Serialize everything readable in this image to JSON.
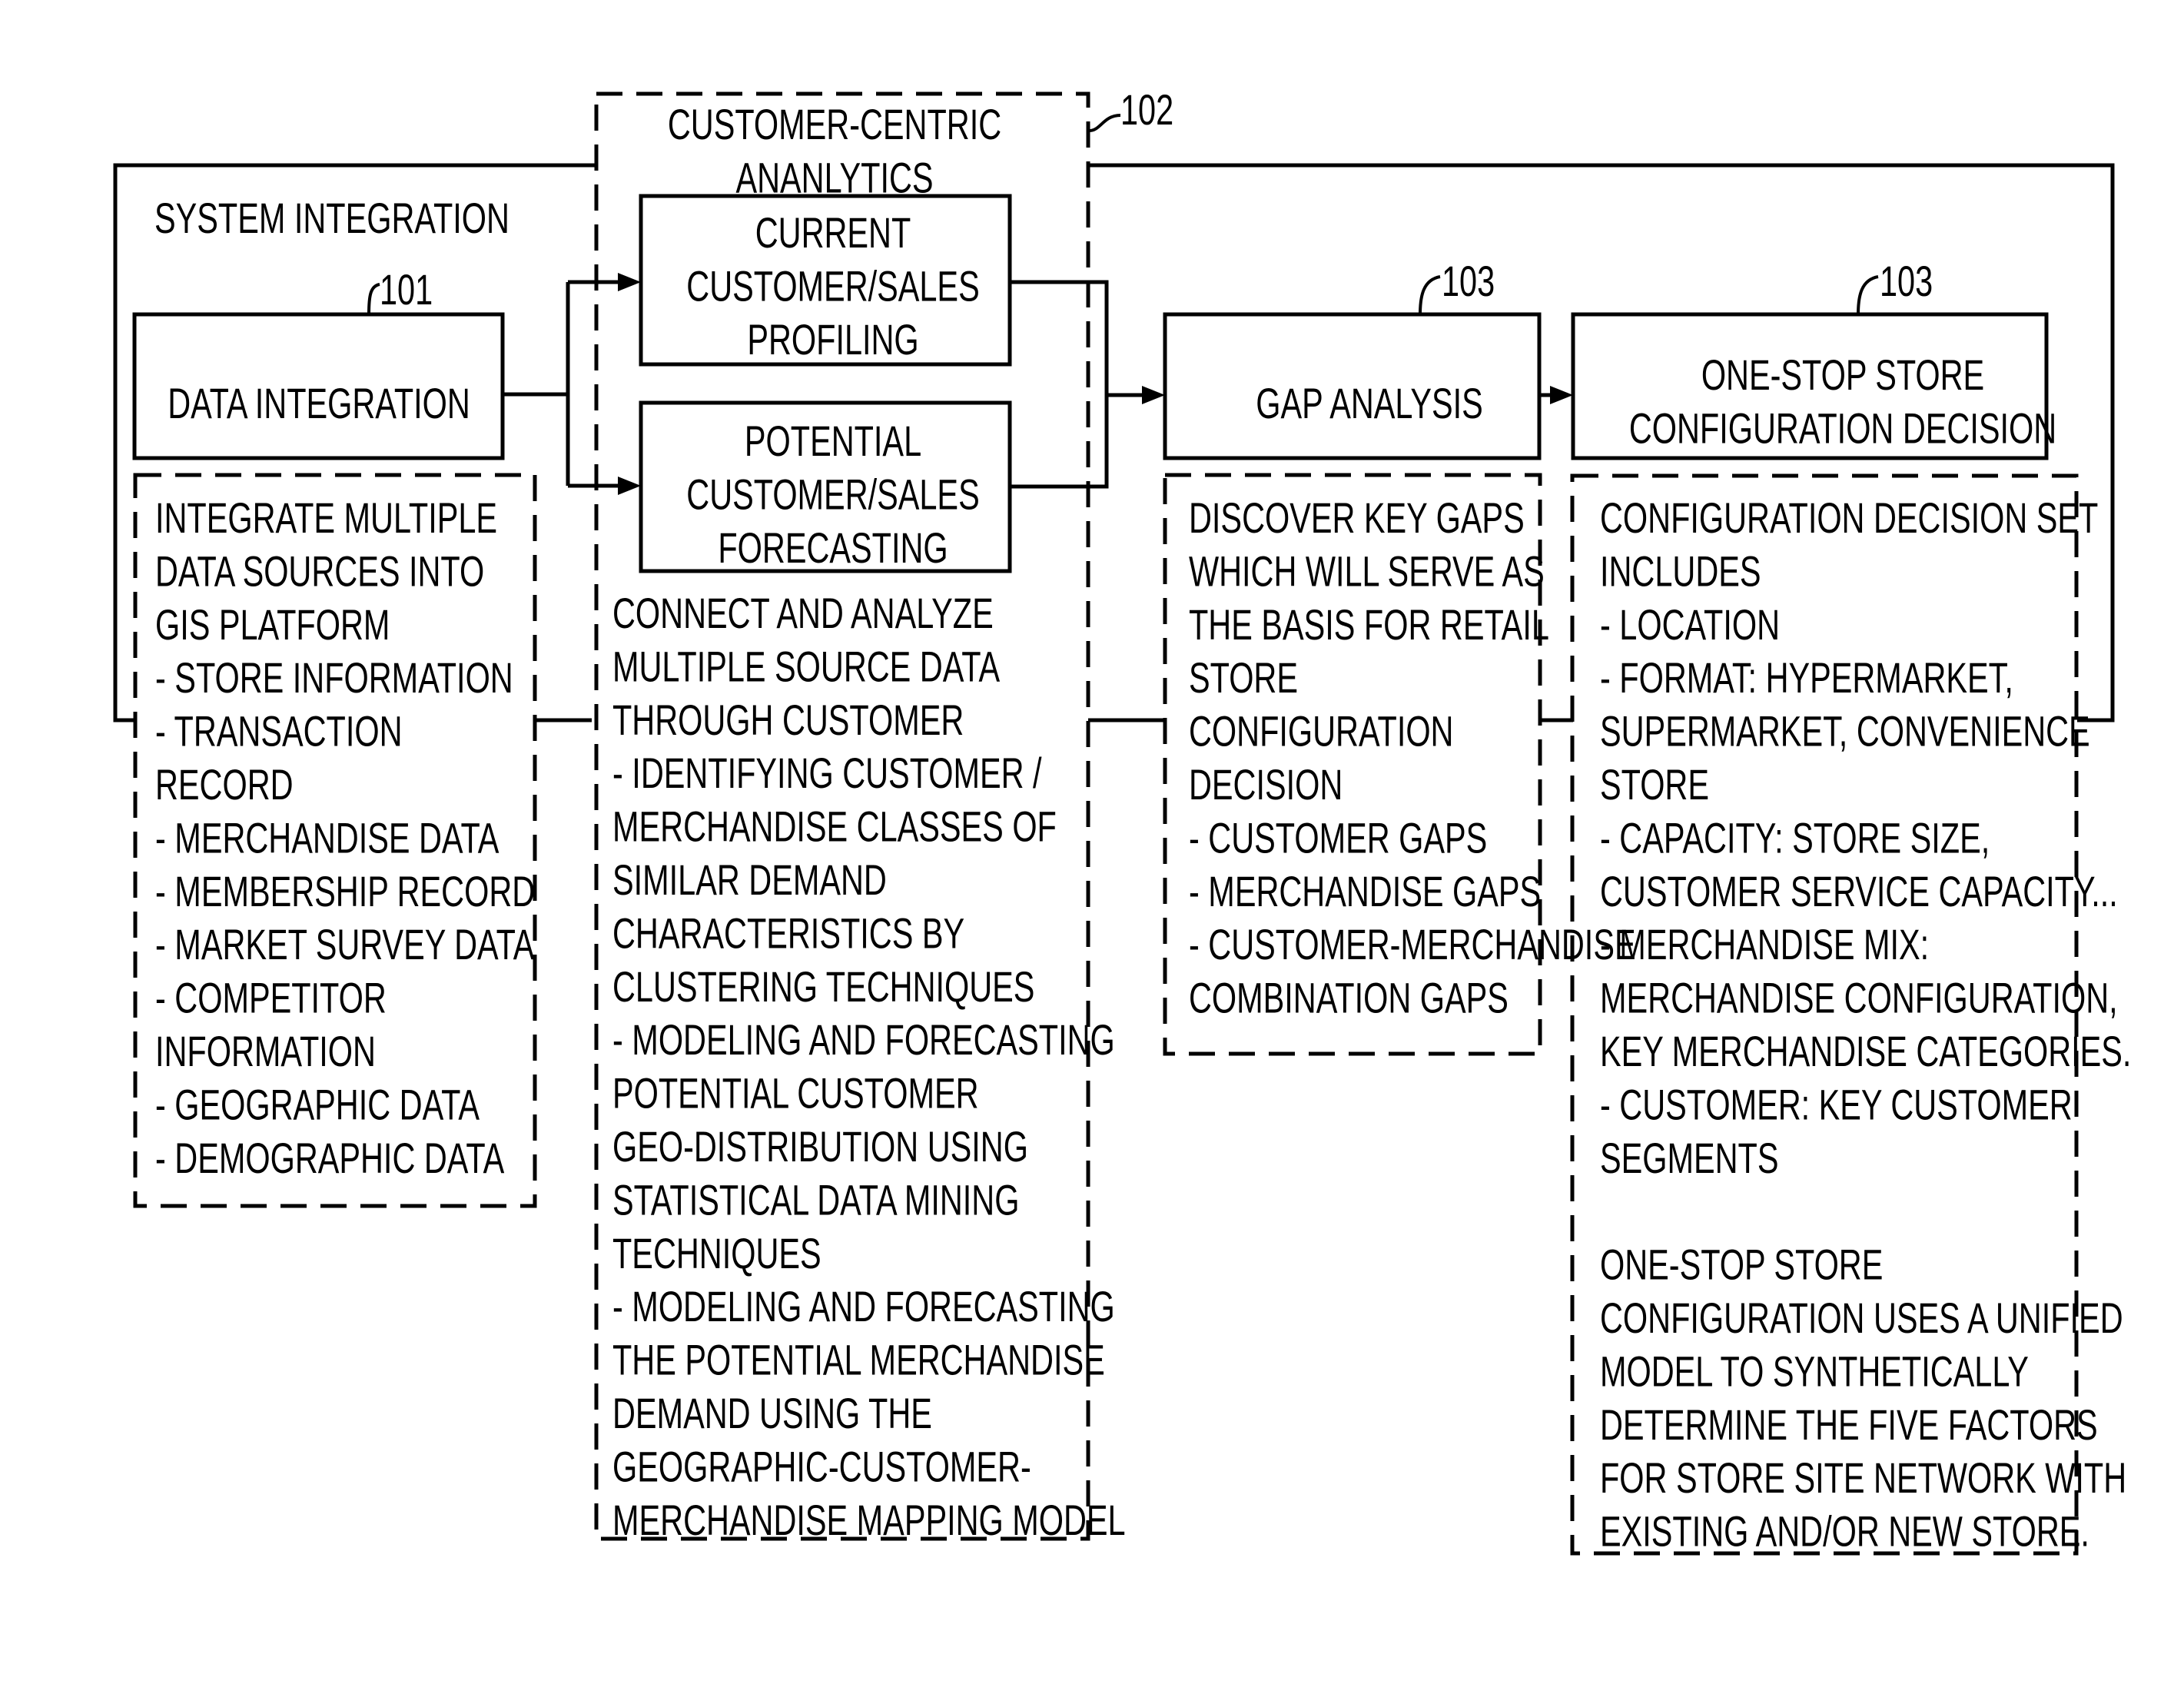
{
  "diagram": {
    "system_frame": {
      "label": "SYSTEM INTEGRATION"
    },
    "data_integration": {
      "ref": "101",
      "title": [
        "DATA INTEGRATION"
      ],
      "details": [
        "INTEGRATE MULTIPLE",
        "DATA SOURCES INTO",
        "GIS PLATFORM",
        "- STORE INFORMATION",
        "- TRANSACTION",
        "RECORD",
        "- MERCHANDISE DATA",
        "- MEMBERSHIP RECORD",
        "- MARKET SURVEY DATA",
        "- COMPETITOR",
        "INFORMATION",
        "- GEOGRAPHIC DATA",
        "- DEMOGRAPHIC DATA"
      ]
    },
    "customer_centric_analytics": {
      "ref": "102",
      "title": [
        "CUSTOMER-CENTRIC",
        "ANANLYTICS"
      ],
      "current_box": [
        "CURRENT",
        "CUSTOMER/SALES",
        "PROFILING"
      ],
      "potential_box": [
        "POTENTIAL",
        "CUSTOMER/SALES",
        "FORECASTING"
      ],
      "details": [
        "CONNECT AND ANALYZE",
        "MULTIPLE SOURCE DATA",
        "THROUGH CUSTOMER",
        "-   IDENTIFYING CUSTOMER /",
        "MERCHANDISE CLASSES OF",
        "SIMILAR DEMAND",
        "CHARACTERISTICS BY",
        "CLUSTERING TECHNIQUES",
        "- MODELING AND FORECASTING",
        "POTENTIAL CUSTOMER",
        "GEO-DISTRIBUTION USING",
        "STATISTICAL DATA MINING",
        "TECHNIQUES",
        "- MODELING AND FORECASTING",
        "THE POTENTIAL MERCHANDISE",
        "DEMAND USING THE",
        "GEOGRAPHIC-CUSTOMER-",
        "MERCHANDISE MAPPING MODEL"
      ]
    },
    "gap_analysis": {
      "ref": "103",
      "title": [
        "GAP ANALYSIS"
      ],
      "details": [
        "DISCOVER KEY GAPS",
        "WHICH WILL SERVE AS",
        "THE BASIS FOR RETAIL",
        "STORE",
        "CONFIGURATION",
        "DECISION",
        "- CUSTOMER GAPS",
        "- MERCHANDISE GAPS",
        "- CUSTOMER-MERCHANDISE",
        "COMBINATION GAPS"
      ]
    },
    "one_stop_store": {
      "ref": "103",
      "title": [
        "ONE-STOP STORE",
        "CONFIGURATION DECISION"
      ],
      "details": [
        "CONFIGURATION DECISION SET",
        "INCLUDES",
        "- LOCATION",
        "- FORMAT: HYPERMARKET,",
        "SUPERMARKET, CONVENIENCE",
        "STORE",
        "- CAPACITY: STORE SIZE,",
        "CUSTOMER SERVICE CAPACITY...",
        "- MERCHANDISE MIX:",
        "MERCHANDISE CONFIGURATION,",
        "KEY MERCHANDISE CATEGORIES.",
        " - CUSTOMER: KEY CUSTOMER",
        "SEGMENTS",
        "",
        "ONE-STOP STORE",
        "CONFIGURATION USES A UNIFIED",
        "MODEL TO SYNTHETICALLY",
        "DETERMINE THE FIVE FACTORS",
        "FOR STORE SITE NETWORK WITH",
        "EXISTING AND/OR NEW STORE."
      ]
    }
  }
}
